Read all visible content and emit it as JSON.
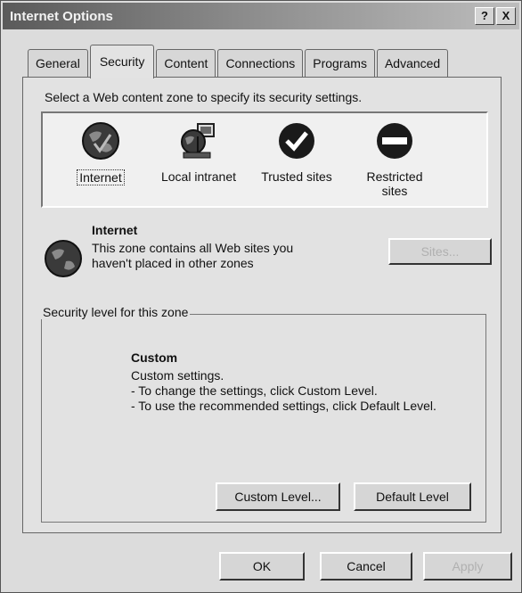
{
  "window": {
    "title": "Internet Options"
  },
  "titlebar": {
    "help": "?",
    "close": "X"
  },
  "tabs": [
    "General",
    "Security",
    "Content",
    "Connections",
    "Programs",
    "Advanced"
  ],
  "prompt": "Select a Web content zone to specify its security settings.",
  "zones": [
    {
      "label": "Internet",
      "icon": "globe-icon"
    },
    {
      "label": "Local intranet",
      "icon": "intranet-icon"
    },
    {
      "label": "Trusted sites",
      "icon": "checkmark-icon"
    },
    {
      "label": "Restricted sites",
      "icon": "restricted-icon"
    }
  ],
  "zone_info": {
    "title": "Internet",
    "description": "This zone contains all Web sites you haven't placed in other zones",
    "sites_button": "Sites..."
  },
  "security_level": {
    "group_label": "Security level for this zone",
    "title": "Custom",
    "line1": "Custom settings.",
    "line2": "- To change the settings, click Custom Level.",
    "line3": "- To use the recommended settings, click Default Level.",
    "custom_button": "Custom Level...",
    "default_button": "Default Level"
  },
  "footer": {
    "ok": "OK",
    "cancel": "Cancel",
    "apply": "Apply"
  }
}
